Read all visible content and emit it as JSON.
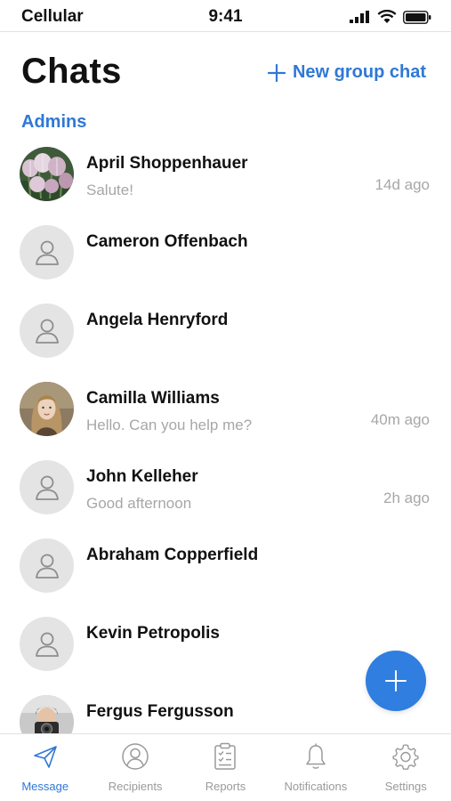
{
  "status_bar": {
    "carrier": "Cellular",
    "time": "9:41"
  },
  "header": {
    "title": "Chats",
    "new_group_label": "New group chat"
  },
  "section": {
    "label": "Admins"
  },
  "chats": [
    {
      "name": "April Shoppenhauer",
      "preview": "Salute!",
      "time": "14d ago",
      "avatar": "photo-tulips"
    },
    {
      "name": "Cameron Offenbach",
      "preview": "",
      "time": "",
      "avatar": "placeholder"
    },
    {
      "name": "Angela Henryford",
      "preview": "",
      "time": "",
      "avatar": "placeholder"
    },
    {
      "name": "Camilla Williams",
      "preview": "Hello. Can you help me?",
      "time": "40m ago",
      "avatar": "photo-woman"
    },
    {
      "name": "John Kelleher",
      "preview": "Good afternoon",
      "time": "2h ago",
      "avatar": "placeholder"
    },
    {
      "name": "Abraham Copperfield",
      "preview": "",
      "time": "",
      "avatar": "placeholder"
    },
    {
      "name": "Kevin Petropolis",
      "preview": "",
      "time": "",
      "avatar": "placeholder"
    },
    {
      "name": "Fergus Fergusson",
      "preview": "",
      "time": "",
      "avatar": "photo-man-camera"
    }
  ],
  "tabs": [
    {
      "label": "Message",
      "icon": "paper-plane-icon",
      "active": true
    },
    {
      "label": "Recipients",
      "icon": "user-circle-icon",
      "active": false
    },
    {
      "label": "Reports",
      "icon": "clipboard-checklist-icon",
      "active": false
    },
    {
      "label": "Notifications",
      "icon": "bell-icon",
      "active": false
    },
    {
      "label": "Settings",
      "icon": "gear-icon",
      "active": false
    }
  ],
  "colors": {
    "accent": "#2f78d6",
    "fab": "#2f7ee0",
    "muted_text": "#a7a7a7",
    "avatar_bg": "#e4e4e4"
  }
}
